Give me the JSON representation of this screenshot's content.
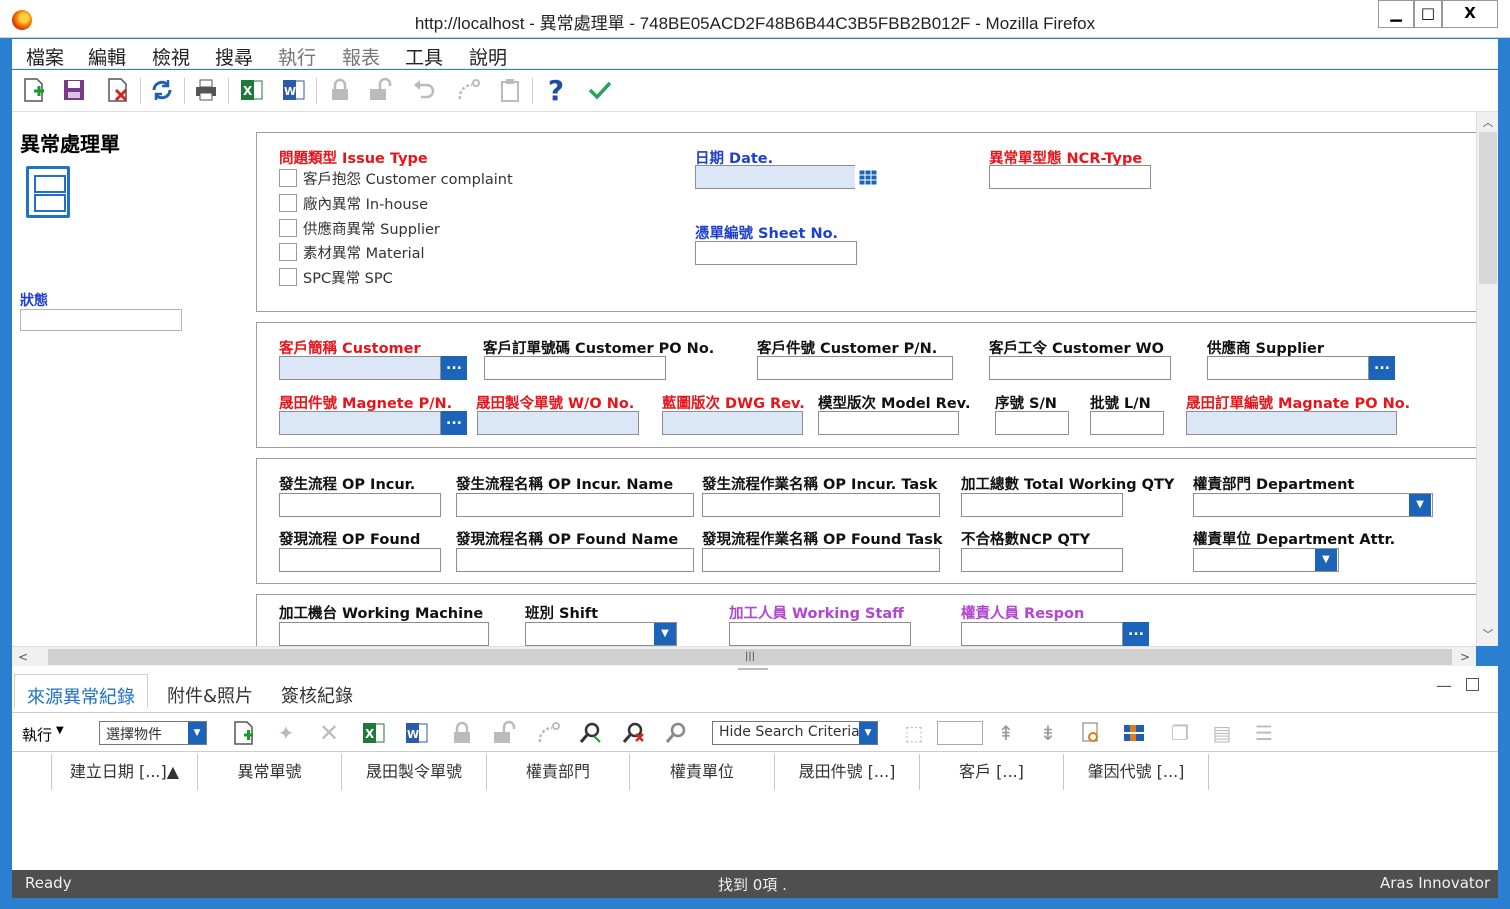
{
  "window": {
    "title": "http://localhost - 異常處理單 - 748BE05ACD2F48B6B44C3B5FBB2B012F - Mozilla Firefox",
    "controls": {
      "minimize": "▁",
      "maximize": "□",
      "close": "X"
    }
  },
  "menu": [
    "檔案",
    "編輯",
    "檢視",
    "搜尋",
    "執行",
    "報表",
    "工具",
    "說明"
  ],
  "toolbar_icons": [
    "new-icon",
    "save-icon",
    "discard-icon",
    "refresh-icon",
    "print-icon",
    "excel-icon",
    "word-icon",
    "lock-icon",
    "unlock-icon",
    "undo-icon",
    "promote-icon",
    "clipboard-icon",
    "help-icon",
    "done-icon"
  ],
  "left": {
    "title": "異常處理單",
    "status_label": "狀態",
    "status_value": ""
  },
  "section1": {
    "issue_type_label": "問題類型 Issue Type",
    "issue_types": [
      "客戶抱怨 Customer complaint",
      "廠內異常 In-house",
      "供應商異常 Supplier",
      "素材異常 Material",
      "SPC異常 SPC"
    ],
    "date_label": "日期 Date.",
    "date_value": "",
    "ncr_type_label": "異常單型態 NCR-Type",
    "sheet_no_label": "憑單編號 Sheet No."
  },
  "section2": {
    "customer": "客戶簡稱 Customer",
    "customer_po": "客戶訂單號碼 Customer PO No.",
    "customer_pn": "客戶件號 Customer P/N.",
    "customer_wo": "客戶工令 Customer WO",
    "supplier": "供應商 Supplier",
    "magnate_pn": "晟田件號 Magnete P/N.",
    "wo_no": "晟田製令單號 W/O No.",
    "dwg_rev": "藍圖版次 DWG Rev.",
    "model_rev": "模型版次 Model Rev.",
    "sn": "序號 S/N",
    "ln": "批號 L/N",
    "magnate_po": "晟田訂單編號 Magnate PO No."
  },
  "section3": {
    "op_incur": "發生流程 OP Incur.",
    "op_incur_name": "發生流程名稱 OP Incur. Name",
    "op_incur_task": "發生流程作業名稱 OP Incur. Task",
    "total_qty": "加工總數 Total Working QTY",
    "department": "權責部門 Department",
    "op_found": "發現流程 OP Found",
    "op_found_name": "發現流程名稱 OP Found Name",
    "op_found_task": "發現流程作業名稱 OP Found Task",
    "ncp_qty": "不合格數NCP QTY",
    "dept_attr": "權責單位 Department Attr."
  },
  "section4": {
    "machine": "加工機台 Working Machine",
    "shift": "班別 Shift",
    "staff": "加工人員 Working Staff",
    "respon": "權責人員 Respon"
  },
  "lower": {
    "tabs": [
      "來源異常紀錄",
      "附件&照片",
      "簽核紀錄"
    ],
    "exec_label": "執行",
    "select_item": "選擇物件",
    "hide_search": "Hide Search Criteria",
    "columns": [
      "建立日期 [...]▲",
      "異常單號",
      "晟田製令單號",
      "權責部門",
      "權責單位",
      "晟田件號 [...]",
      "客戶 [...]",
      "肇因代號 [...]"
    ]
  },
  "status": {
    "left": "Ready",
    "center": "找到 0項 .",
    "right": "Aras Innovator"
  },
  "colors": {
    "accent": "#1c64b9",
    "required": "#e8141a",
    "optional": "#1f3fd0",
    "staff": "#b146d0"
  }
}
